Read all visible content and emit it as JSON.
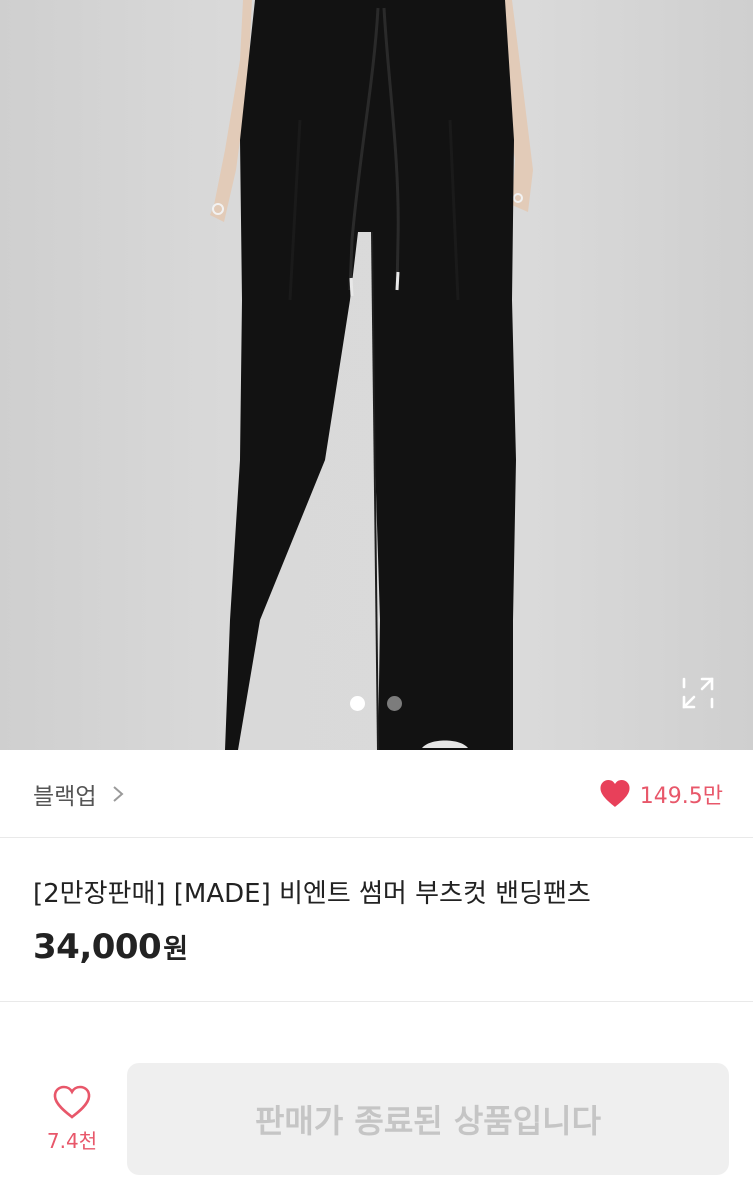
{
  "gallery": {
    "image_desc": "product-photo",
    "dots": [
      {
        "state": "active"
      },
      {
        "state": "inactive"
      }
    ],
    "expand_icon": "expand-icon"
  },
  "shop": {
    "name": "블랙업",
    "chevron_icon": "chevron-right-icon",
    "likes_icon": "heart-filled-icon",
    "likes_count": "149.5만"
  },
  "product": {
    "title": "[2만장판매] [MADE] 비엔트 썸머 부츠컷 밴딩팬츠",
    "price": "34,000",
    "currency": "원"
  },
  "bottom_bar": {
    "wish_icon": "heart-outline-icon",
    "wish_count": "7.4천",
    "buy_label": "판매가 종료된 상품입니다"
  },
  "colors": {
    "accent": "#e8576a",
    "disabled_bg": "#efefef",
    "disabled_text": "#c5c5c5"
  }
}
